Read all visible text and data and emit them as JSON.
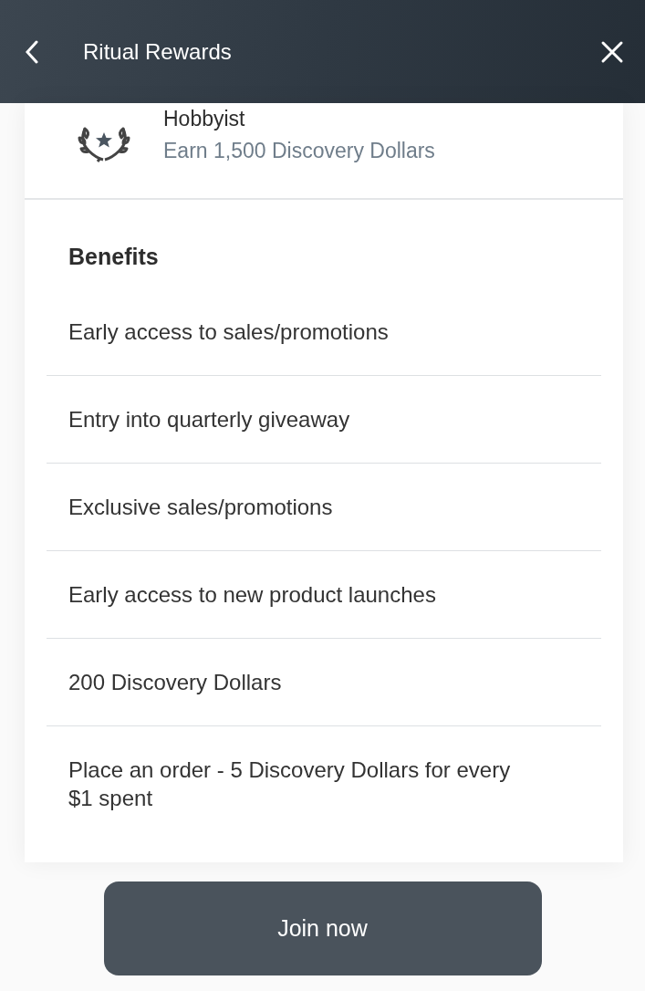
{
  "header": {
    "title": "Ritual Rewards"
  },
  "tier": {
    "name": "Hobbyist",
    "requirement": "Earn 1,500 Discovery Dollars"
  },
  "benefits": {
    "heading": "Benefits",
    "items": [
      "Early access to sales/promotions",
      "Entry into quarterly giveaway",
      "Exclusive sales/promotions",
      "Early access to new product launches",
      "200 Discovery Dollars",
      "Place an order - 5 Discovery Dollars for every $1 spent"
    ]
  },
  "action": {
    "label": "Join now"
  }
}
